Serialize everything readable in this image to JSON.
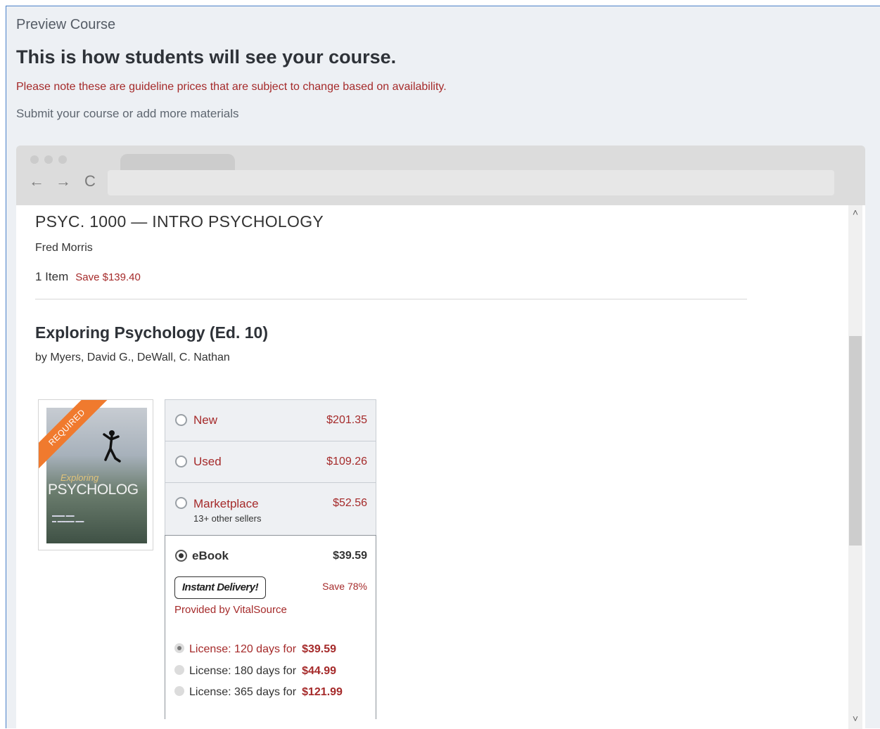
{
  "page": {
    "eyebrow": "Preview Course",
    "headline": "This is how students will see your course.",
    "note": "Please note these are guideline prices that are subject to change based on availability.",
    "submit_link": "Submit your course or add more materials"
  },
  "browser": {
    "nav_icons": [
      "back-arrow-icon",
      "forward-arrow-icon",
      "reload-icon"
    ],
    "nav_glyphs": {
      "back": "←",
      "forward": "→",
      "reload": "C"
    },
    "scroll_glyphs": {
      "up": "˄",
      "down": "˅"
    }
  },
  "course": {
    "title": "PSYC. 1000 — INTRO PSYCHOLOGY",
    "instructor": "Fred Morris",
    "items": "1 Item",
    "savings": "Save $139.40"
  },
  "book": {
    "title": "Exploring Psychology (Ed. 10)",
    "author": "by Myers, David G., DeWall, C. Nathan",
    "badge": "REQUIRED",
    "cover_title": "PSYCHOLOG",
    "cover_script": "Exploring"
  },
  "options": [
    {
      "label": "New",
      "price": "$201.35"
    },
    {
      "label": "Used",
      "price": "$109.26"
    },
    {
      "label": "Marketplace",
      "price": "$52.56",
      "sub": "13+ other sellers"
    }
  ],
  "ebook": {
    "label": "eBook",
    "price": "$39.59",
    "instant": "Instant Delivery!",
    "save": "Save 78%",
    "provider": "Provided by VitalSource",
    "licenses": [
      {
        "text": "License: 120 days for",
        "price": "$39.59"
      },
      {
        "text": "License: 180 days for",
        "price": "$44.99"
      },
      {
        "text": "License: 365 days for",
        "price": "$121.99"
      }
    ]
  },
  "colors": {
    "accent_red": "#a52a2a",
    "ribbon": "#f07a2e",
    "panel_bg": "#edf0f4"
  }
}
